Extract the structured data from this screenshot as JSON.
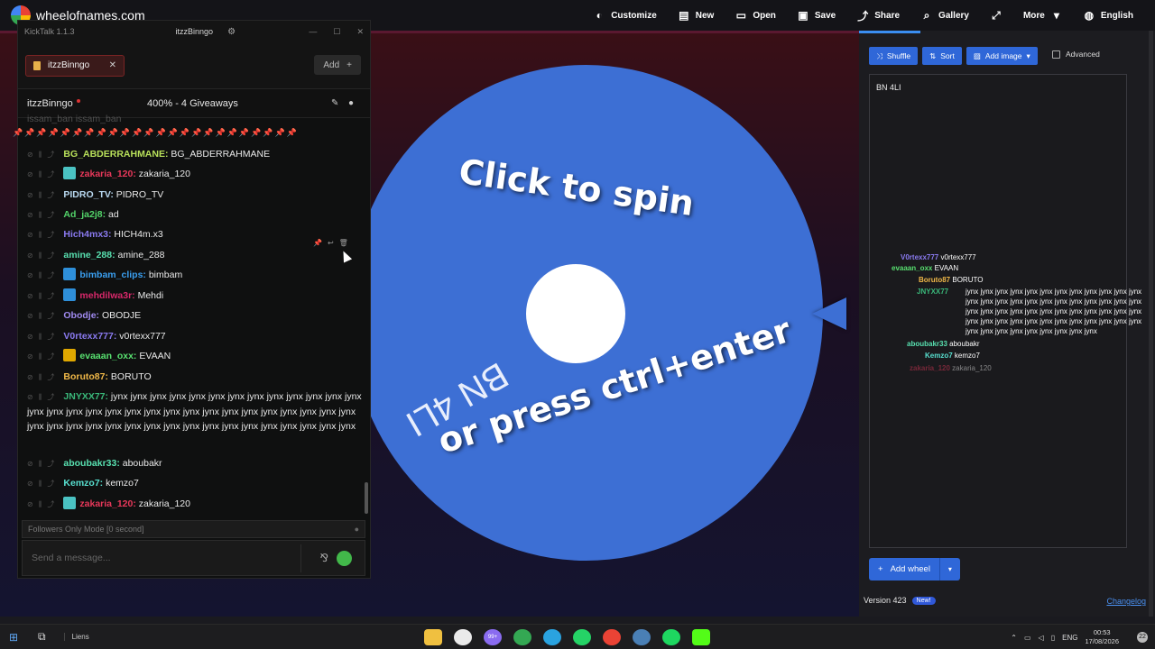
{
  "topbar": {
    "site_name": "wheelofnames.com",
    "nav": [
      {
        "label": "Customize",
        "icon": "palette-icon",
        "glyph": "◐"
      },
      {
        "label": "New",
        "icon": "file-icon",
        "glyph": "▤"
      },
      {
        "label": "Open",
        "icon": "folder-icon",
        "glyph": "▭"
      },
      {
        "label": "Save",
        "icon": "save-icon",
        "glyph": "▣"
      },
      {
        "label": "Share",
        "icon": "share-icon",
        "glyph": "⤴"
      },
      {
        "label": "Gallery",
        "icon": "search-icon",
        "glyph": "⌕"
      },
      {
        "label": "",
        "icon": "fullscreen-icon",
        "glyph": "⤢"
      },
      {
        "label": "More",
        "icon": "chevron-down-icon",
        "glyph": "▾"
      },
      {
        "label": "English",
        "icon": "globe-icon",
        "glyph": "◍"
      }
    ]
  },
  "wheel": {
    "spin_line1": "Click to spin",
    "spin_line2": "or press ctrl+enter",
    "entry": "BN 4LI",
    "color": "#3d6fd4"
  },
  "kicktalk": {
    "app_title": "KickTalk 1.1.3",
    "channel_title": "itzzBinngo",
    "tab_label": "itzzBinngo",
    "add_label": "Add",
    "stream_name": "itzzBinngo",
    "giveaways": "400% - 4 Giveaways",
    "pinned_top": "issam_ban  issam_ban",
    "messages": [
      {
        "user": "BG_ABDERRAHMANE:",
        "text": "BG_ABDERRAHMANE",
        "color": "#b8e05a",
        "badge": ""
      },
      {
        "user": "zakaria_120:",
        "text": "zakaria_120",
        "color": "#e8385a",
        "badge": "og"
      },
      {
        "user": "PIDRO_TV:",
        "text": "PIDRO_TV",
        "color": "#b8d8f0",
        "badge": ""
      },
      {
        "user": "Ad_ja2j8:",
        "text": "ad",
        "color": "#53d46a",
        "badge": ""
      },
      {
        "user": "Hich4mx3:",
        "text": "HICH4m.x3",
        "color": "#8a7af0",
        "badge": ""
      },
      {
        "user": "amine_288:",
        "text": "amine_288",
        "color": "#58e0b0",
        "badge": ""
      },
      {
        "user": "bimbam_clips:",
        "text": "bimbam",
        "color": "#3a9ff0",
        "badge": "sub"
      },
      {
        "user": "mehdilwa3r:",
        "text": "Mehdi",
        "color": "#d8286a",
        "badge": "sub"
      },
      {
        "user": "Obodje:",
        "text": "OBODJE",
        "color": "#a08af0",
        "badge": ""
      },
      {
        "user": "V0rtexx777:",
        "text": "v0rtexx777",
        "color": "#8a7af0",
        "badge": ""
      },
      {
        "user": "evaaan_oxx:",
        "text": "EVAAN",
        "color": "#58e070",
        "badge": "vip"
      },
      {
        "user": "Boruto87:",
        "text": "BORUTO",
        "color": "#f0b848",
        "badge": ""
      },
      {
        "user": "JNYXX77:",
        "text": "jynx jynx jynx jynx jynx jynx jynx jynx jynx jynx jynx jynx jynx jynx jynx jynx jynx jynx jynx jynx jynx jynx jynx jynx jynx jynx jynx jynx jynx jynx jynx jynx jynx jynx jynx jynx jynx jynx jynx jynx jynx jynx jynx jynx jynx jynx jynx",
        "color": "#3ab87a",
        "badge": ""
      },
      {
        "user": "aboubakr33:",
        "text": "aboubakr",
        "color": "#58e0b0",
        "badge": ""
      },
      {
        "user": "Kemzo7:",
        "text": "kemzo7",
        "color": "#58e0d0",
        "badge": ""
      },
      {
        "user": "zakaria_120:",
        "text": "zakaria_120",
        "color": "#e8385a",
        "badge": "og"
      }
    ],
    "followers_mode": "Followers Only Mode [0 second]",
    "input_placeholder": "Send a message..."
  },
  "panel": {
    "shuffle_label": "Shuffle",
    "sort_label": "Sort",
    "add_image_label": "Add image",
    "advanced_label": "Advanced",
    "entries": "BN 4LI",
    "mirror_rows": [
      {
        "user": "V0rtexx777",
        "text": "v0rtexx777",
        "color": "#8a7af0"
      },
      {
        "user": "evaaan_oxx",
        "text": "EVAAN",
        "color": "#58e070"
      },
      {
        "user": "Boruto87",
        "text": "BORUTO",
        "color": "#f0b848"
      },
      {
        "user": "JNYXX77",
        "text": "jynx jynx jynx jynx jynx jynx jynx jynx jynx",
        "color": "#3ab87a"
      },
      {
        "user": "aboubakr33",
        "text": "aboubakr",
        "color": "#58e0b0"
      },
      {
        "user": "Kemzo7",
        "text": "kemzo7",
        "color": "#58e0d0"
      },
      {
        "user": "zakaria_120",
        "text": "zakaria_120",
        "color": "#e8385a"
      }
    ],
    "mirror_jynx": "jynx jynx jynx jynx jynx jynx jynx jynx jynx jynx jynx jynx jynx jynx jynx jynx jynx jynx jynx jynx jynx jynx jynx jynx jynx jynx jynx jynx jynx jynx jynx jynx jynx jynx jynx jynx jynx jynx jynx jynx jynx jynx jynx jynx jynx jynx jynx jynx jynx jynx jynx jynx jynx jynx jynx jynx jynx",
    "add_wheel_label": "Add wheel",
    "version": "Version 423",
    "new_badge": "New!",
    "changelog": "Changelog"
  },
  "taskbar": {
    "liens": "Liens",
    "badge_count": "99+",
    "lang": "ENG",
    "time": "00:53",
    "date": "17/08/2026",
    "notif_count": "22",
    "app_colors": [
      "#f0c040",
      "#eaeaea",
      "#8a6cf0",
      "#34a853",
      "#2aa3e0",
      "#25d366",
      "#ea4335",
      "#4a7fb5",
      "#1ed760",
      "#53fc18"
    ]
  }
}
